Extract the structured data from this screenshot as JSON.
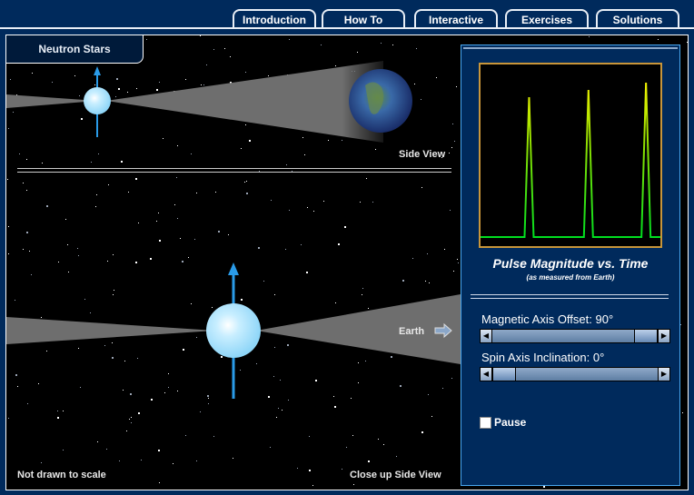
{
  "tabs": [
    {
      "label": "Introduction",
      "active": false
    },
    {
      "label": "How To",
      "active": false
    },
    {
      "label": "Interactive",
      "active": true
    },
    {
      "label": "Exercises",
      "active": false
    },
    {
      "label": "Solutions",
      "active": false
    }
  ],
  "scene": {
    "title": "Neutron Stars",
    "side_view_label": "Side View",
    "earth_label": "Earth",
    "footer_left": "Not drawn to scale",
    "footer_right": "Close up Side View",
    "beam_color": "#6e6e6e",
    "star_color": "#aee4ff",
    "axis_color": "#2a9be8"
  },
  "panel": {
    "graph_title": "Pulse Magnitude vs. Time",
    "graph_subtitle": "(as measured from Earth)",
    "pulses": {
      "count": 3,
      "positions": [
        0.27,
        0.6,
        0.92
      ],
      "peak_heights": [
        0.82,
        0.86,
        0.9
      ],
      "baseline": 0.05
    },
    "sliders": [
      {
        "label": "Magnetic Axis Offset: 90°",
        "value": 90,
        "min": 0,
        "max": 90,
        "fraction": 1.0
      },
      {
        "label": "Spin Axis Inclination: 0°",
        "value": 0,
        "min": 0,
        "max": 90,
        "fraction": 0.0
      }
    ],
    "pause_label": "Pause",
    "pause_checked": false,
    "border_color": "#c8953a"
  }
}
